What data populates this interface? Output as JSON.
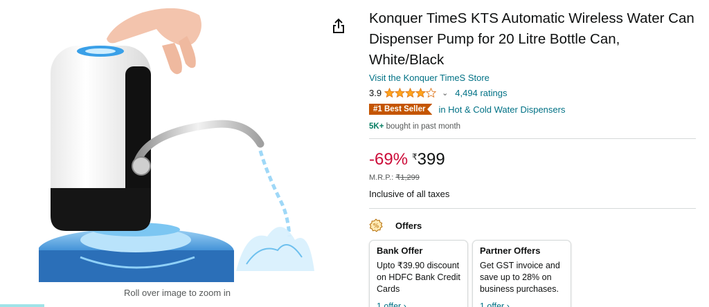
{
  "product": {
    "title": "Konquer TimeS KTS Automatic Wireless Water Can Dispenser Pump for 20 Litre Bottle Can, White/Black",
    "store_link": "Visit the Konquer TimeS Store",
    "rating_value": "3.9",
    "rating_stars": 3.9,
    "ratings_count": "4,494 ratings",
    "bestseller_badge": "#1 Best Seller",
    "bestseller_category": "in Hot & Cold Water Dispensers",
    "bought_count": "5K+",
    "bought_text": "bought in past month"
  },
  "pricing": {
    "discount": "-69%",
    "currency_symbol": "₹",
    "price": "399",
    "mrp_label": "M.R.P.:",
    "mrp_value": "₹1,299",
    "taxes": "Inclusive of all taxes"
  },
  "offers": {
    "title": "Offers",
    "cards": [
      {
        "title": "Bank Offer",
        "text": "Upto ₹39.90 discount on HDFC Bank Credit Cards",
        "link": "1 offer ›"
      },
      {
        "title": "Partner Offers",
        "text": "Get GST invoice and save up to 28% on business purchases.",
        "link": "1 offer ›"
      }
    ]
  },
  "image": {
    "zoom_hint": "Roll over image to zoom in"
  },
  "icons": {
    "share": "share-icon",
    "offers": "offers-percent-icon",
    "chevron": "chevron-down-icon",
    "star": "star-icon"
  },
  "colors": {
    "link": "#007185",
    "discount": "#cc0c39",
    "badge": "#c45500",
    "star": "#ffa41c",
    "bought": "#067d62"
  }
}
